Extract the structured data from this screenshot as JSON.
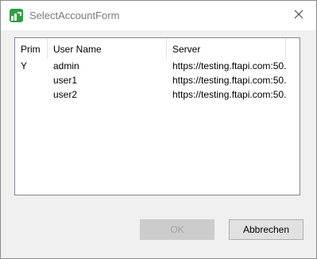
{
  "window": {
    "title": "SelectAccountForm"
  },
  "table": {
    "columns": [
      "Prim",
      "User Name",
      "Server"
    ],
    "rows": [
      {
        "prim": "Y",
        "user": "admin",
        "server": "https://testing.ftapi.com:50..."
      },
      {
        "prim": "",
        "user": "user1",
        "server": "https://testing.ftapi.com:50..."
      },
      {
        "prim": "",
        "user": "user2",
        "server": "https://testing.ftapi.com:50..."
      }
    ]
  },
  "buttons": {
    "ok_label": "OK",
    "cancel_label": "Abbrechen"
  },
  "colors": {
    "app_icon": "#2f9e44",
    "ok_disabled_bg": "#cccccc",
    "cancel_bg": "#e1e1e1"
  },
  "icons": {
    "app": "app-icon",
    "close": "close-icon"
  }
}
